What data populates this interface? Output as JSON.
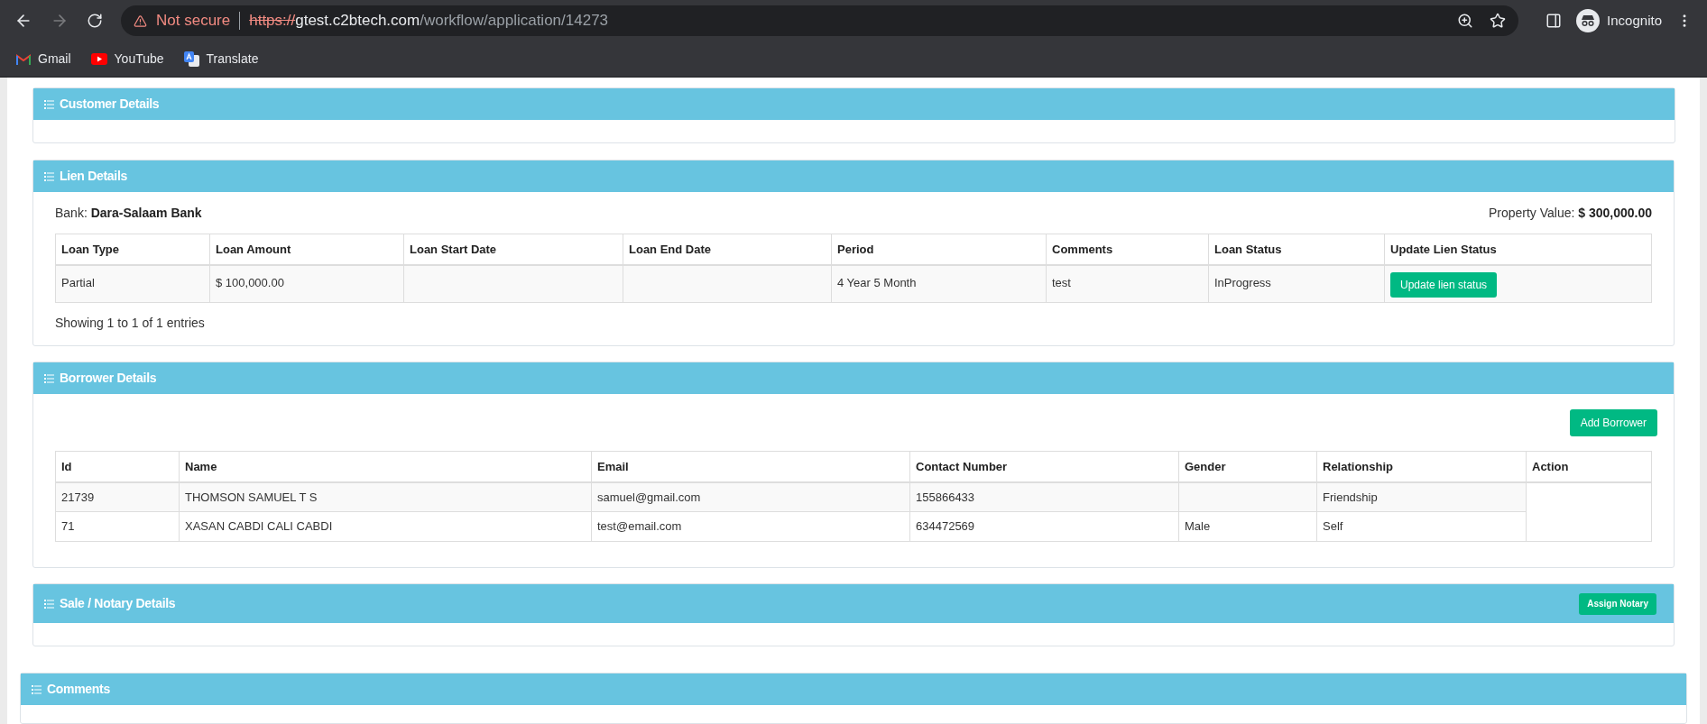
{
  "browser": {
    "security": "Not secure",
    "url_scheme": "https://",
    "url_host": "gtest.c2btech.com",
    "url_path": "/workflow/application/14273",
    "profile": "Incognito",
    "back_disabled": false,
    "forward_disabled": true,
    "bookmarks": [
      {
        "kind": "gmail",
        "label": "Gmail"
      },
      {
        "kind": "youtube",
        "label": "YouTube"
      },
      {
        "kind": "translate",
        "label": "Translate"
      }
    ]
  },
  "customer": {
    "title": "Customer Details"
  },
  "lien": {
    "title": "Lien Details",
    "bank_label": "Bank:",
    "bank": "Dara-Salaam Bank",
    "property_label": "Property Value:",
    "property_value": "$ 300,000.00",
    "columns": [
      "Loan Type",
      "Loan Amount",
      "Loan Start Date",
      "Loan End Date",
      "Period",
      "Comments",
      "Loan Status",
      "Update Lien Status"
    ],
    "rows": [
      {
        "cells": [
          "Partial",
          "$ 100,000.00",
          "",
          "",
          "4 Year 5 Month",
          "test",
          "InProgress"
        ],
        "action": "Update lien status"
      }
    ],
    "footer": "Showing 1 to 1 of 1 entries"
  },
  "borrower": {
    "title": "Borrower Details",
    "add_button": "Add Borrower",
    "columns": [
      "Id",
      "Name",
      "Email",
      "Contact Number",
      "Gender",
      "Relationship",
      "Action"
    ],
    "rows": [
      {
        "cells": [
          "21739",
          "THOMSON SAMUEL T S",
          "samuel@gmail.com",
          "155866433",
          "",
          "Friendship"
        ]
      },
      {
        "cells": [
          "71",
          "XASAN CABDI CALI CABDI",
          "test@email.com",
          "634472569",
          "Male",
          "Self"
        ]
      }
    ]
  },
  "sale": {
    "title": "Sale / Notary Details",
    "button": "Assign Notary"
  },
  "comments": {
    "title": "Comments"
  }
}
